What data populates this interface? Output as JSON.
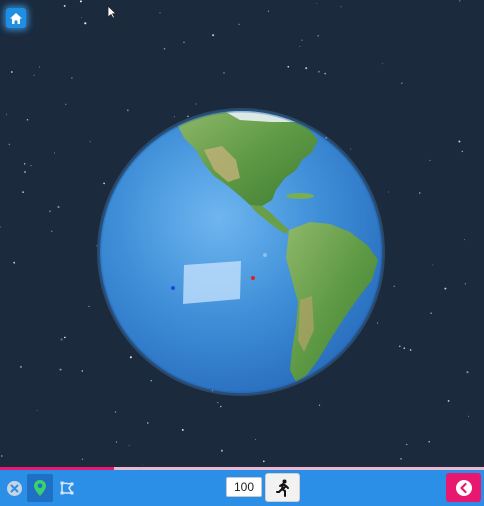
{
  "view": {
    "home_icon": "home-icon",
    "cursor_icon": "arrow-cursor-icon",
    "globe": {
      "ocean_color": "#3f8fd8",
      "land_color": "#5f9a45",
      "markers": [
        {
          "name": "blue-point",
          "color": "#2244dd"
        },
        {
          "name": "red-point",
          "color": "#dd2222"
        }
      ],
      "selection_fill": "#cfe6ff"
    }
  },
  "progress": {
    "value_percent": 23.5,
    "track_color": "#e9b9cf",
    "fill_color": "#e8176f"
  },
  "toolbar": {
    "background": "#2b8fe8",
    "close_icon": "close-circle-icon",
    "marker_icon": "map-marker-icon",
    "polygon_icon": "polygon-tool-icon",
    "speed_value": "100",
    "run_icon": "running-person-icon",
    "back_icon": "chevron-left-icon",
    "accent": "#e8176f"
  }
}
